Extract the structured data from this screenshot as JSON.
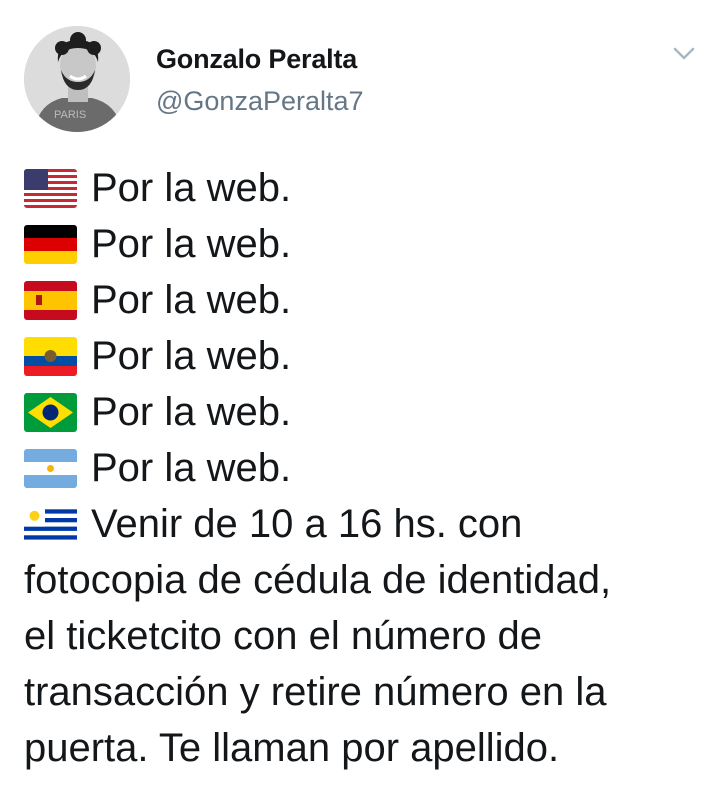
{
  "user": {
    "display_name": "Gonzalo Peralta",
    "handle": "@GonzaPeralta7",
    "avatar_shirt_text": "PARIS"
  },
  "menu_icon": "chevron-down-icon",
  "tweet": {
    "lines": [
      {
        "flag": "usa-flag-icon",
        "text": "Por la web."
      },
      {
        "flag": "germany-flag-icon",
        "text": "Por la web."
      },
      {
        "flag": "spain-flag-icon",
        "text": "Por la web."
      },
      {
        "flag": "ecuador-flag-icon",
        "text": "Por la web."
      },
      {
        "flag": "brazil-flag-icon",
        "text": "Por la web."
      },
      {
        "flag": "argentina-flag-icon",
        "text": "Por la web."
      }
    ],
    "final_flag": "uruguay-flag-icon",
    "final_first_line": "Venir de 10 a 16 hs. con",
    "final_rest": [
      "fotocopia de cédula de identidad,",
      "el ticketcito con el número de",
      "transacción y retire número en la",
      "puerta. Te llaman por apellido."
    ]
  },
  "colors": {
    "name": "#14171a",
    "handle": "#657786",
    "text": "#14171a",
    "chevron": "#aab8c2"
  }
}
